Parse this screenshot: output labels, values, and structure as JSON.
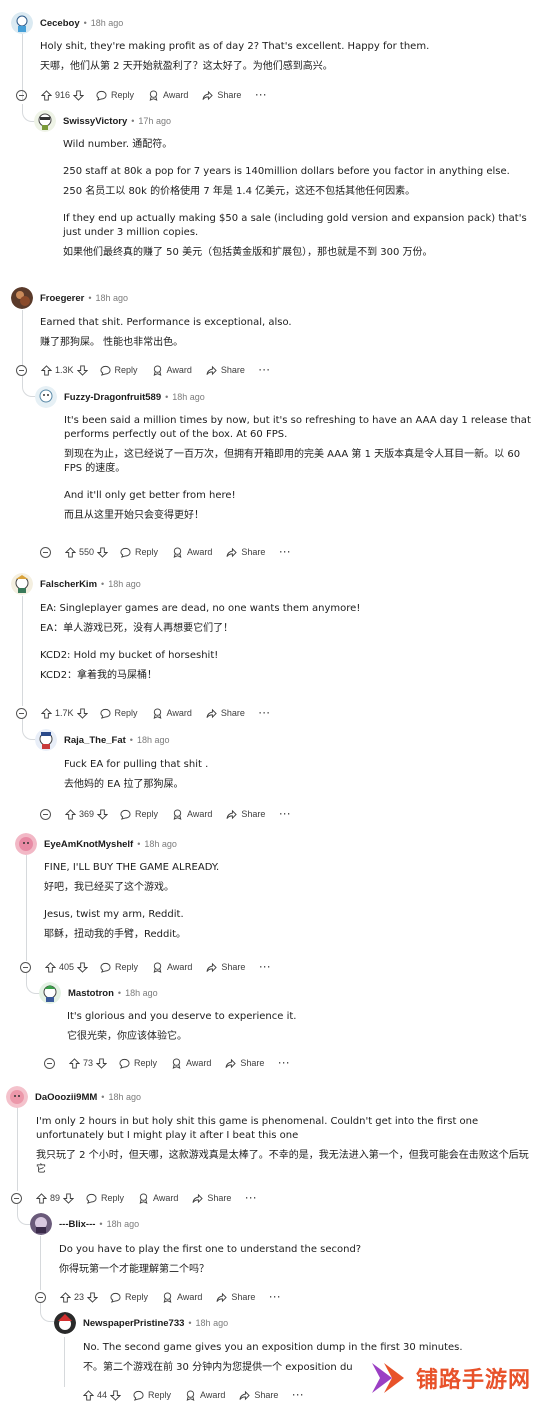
{
  "colors": {
    "watermark": "#e8522a",
    "thread": "#d6d9dc"
  },
  "comments": [
    {
      "user": "Ceceboy",
      "time": "18h ago",
      "lines": [
        "Holy shit, they're making profit as of day 2? That's excellent. Happy for them.",
        "天哪，他们从第 2 天开始就盈利了？这太好了。为他们感到高兴。"
      ],
      "votes": "916",
      "reply": "Reply",
      "award": "Award",
      "share": "Share",
      "more": "···"
    },
    {
      "user": "SwissyVictory",
      "time": "17h ago",
      "lines": [
        "Wild number.  通配符。",
        "250 staff at 80k a pop for 7 years is 140million dollars before you factor in anything else.",
        "250 名员工以 80k 的价格使用 7 年是 1.4 亿美元，这还不包括其他任何因素。",
        "If they end up actually making $50 a sale (including gold version and expansion pack) that's just under 3 million copies.",
        "如果他们最终真的赚了 50 美元（包括黄金版和扩展包），那也就是不到 300 万份。"
      ]
    },
    {
      "user": "Froegerer",
      "time": "18h ago",
      "lines": [
        "Earned that shit. Performance is exceptional, also.",
        "赚了那狗屎。 性能也非常出色。"
      ],
      "votes": "1.3K",
      "reply": "Reply",
      "award": "Award",
      "share": "Share",
      "more": "···"
    },
    {
      "user": "Fuzzy-Dragonfruit589",
      "time": "18h ago",
      "lines": [
        "It's been said a million times by now, but it's so refreshing to have an AAA day 1 release that performs perfectly out of the box. At 60 FPS.",
        "到现在为止，这已经说了一百万次，但拥有开箱即用的完美 AAA 第 1 天版本真是令人耳目一新。以 60 FPS 的速度。",
        "And it'll only get better from here!",
        "而且从这里开始只会变得更好！"
      ],
      "votes": "550",
      "reply": "Reply",
      "award": "Award",
      "share": "Share",
      "more": "···"
    },
    {
      "user": "FalscherKim",
      "time": "18h ago",
      "lines": [
        "EA: Singleplayer games are dead, no one wants them anymore!",
        "EA：单人游戏已死，没有人再想要它们了！",
        "KCD2: Hold my bucket of horseshit!",
        "KCD2：拿着我的马屎桶！"
      ],
      "votes": "1.7K",
      "reply": "Reply",
      "award": "Award",
      "share": "Share",
      "more": "···"
    },
    {
      "user": "Raja_The_Fat",
      "time": "18h ago",
      "lines": [
        "Fuck EA for pulling that shit .",
        "去他妈的 EA 拉了那狗屎。"
      ],
      "votes": "369",
      "reply": "Reply",
      "award": "Award",
      "share": "Share",
      "more": "···"
    },
    {
      "user": "EyeAmKnotMyshelf",
      "time": "18h ago",
      "lines": [
        "FINE, I'LL BUY THE GAME ALREADY.",
        "好吧，我已经买了这个游戏。",
        "Jesus, twist my arm, Reddit.",
        "耶稣，扭动我的手臂，Reddit。"
      ],
      "votes": "405",
      "reply": "Reply",
      "award": "Award",
      "share": "Share",
      "more": "···"
    },
    {
      "user": "Mastotron",
      "time": "18h ago",
      "lines": [
        "It's glorious and you deserve to experience it.",
        "它很光荣，你应该体验它。"
      ],
      "votes": "73",
      "reply": "Reply",
      "award": "Award",
      "share": "Share",
      "more": "···"
    },
    {
      "user": "DaOoozii9MM",
      "time": "18h ago",
      "lines": [
        "I'm only 2 hours in but holy shit this game is phenomenal. Couldn't get into the first one unfortunately but I might play it after I beat this one",
        "我只玩了 2 个小时，但天哪，这款游戏真是太棒了。不幸的是，我无法进入第一个，但我可能会在击败这个后玩它"
      ],
      "votes": "89",
      "reply": "Reply",
      "award": "Award",
      "share": "Share",
      "more": "···"
    },
    {
      "user": "---Blix---",
      "time": "18h ago",
      "lines": [
        "Do you have to play the first one to understand the second?",
        "你得玩第一个才能理解第二个吗？"
      ],
      "votes": "23",
      "reply": "Reply",
      "award": "Award",
      "share": "Share",
      "more": "···"
    },
    {
      "user": "NewspaperPristine733",
      "time": "18h ago",
      "lines": [
        "No. The second game gives you an exposition dump in the first 30 minutes.",
        "不。第二个游戏在前 30 分钟内为您提供一个 exposition du"
      ],
      "votes": "44",
      "reply": "Reply",
      "award": "Award",
      "share": "Share",
      "more": "···"
    }
  ],
  "watermark": {
    "text": "铺路手游网"
  }
}
